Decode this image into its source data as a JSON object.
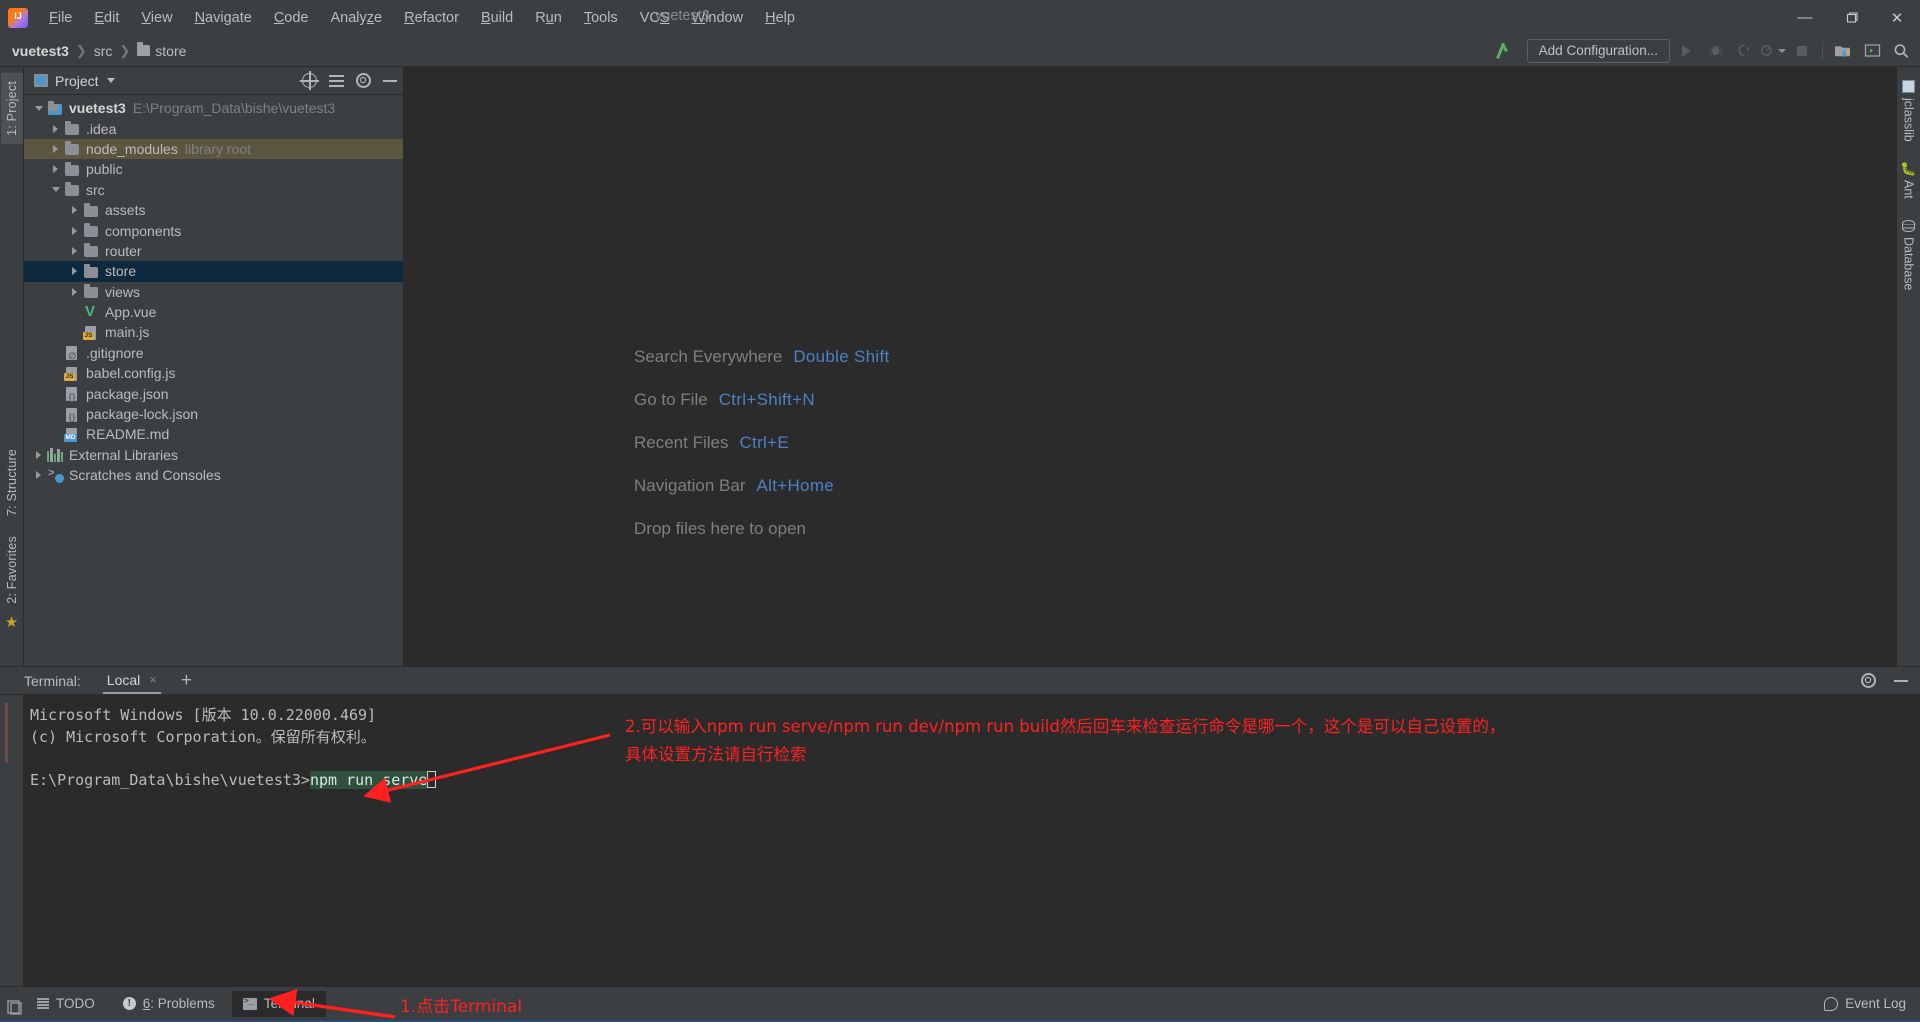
{
  "window": {
    "title": "vuetest3",
    "controls": {
      "minimize": "—",
      "maximize": "❐",
      "close": "✕"
    }
  },
  "menubar": {
    "items": [
      {
        "label": "File",
        "mnemonic": "F"
      },
      {
        "label": "Edit",
        "mnemonic": "E"
      },
      {
        "label": "View",
        "mnemonic": "V"
      },
      {
        "label": "Navigate",
        "mnemonic": "N"
      },
      {
        "label": "Code",
        "mnemonic": "C"
      },
      {
        "label": "Analyze",
        "mnemonic": "z"
      },
      {
        "label": "Refactor",
        "mnemonic": "R"
      },
      {
        "label": "Build",
        "mnemonic": "B"
      },
      {
        "label": "Run",
        "mnemonic": "u"
      },
      {
        "label": "Tools",
        "mnemonic": "T"
      },
      {
        "label": "VCS",
        "mnemonic": "S"
      },
      {
        "label": "Window",
        "mnemonic": "W"
      },
      {
        "label": "Help",
        "mnemonic": "H"
      }
    ]
  },
  "navbar": {
    "breadcrumbs": [
      "vuetest3",
      "src",
      "store"
    ],
    "add_configuration": "Add Configuration..."
  },
  "project_panel": {
    "title": "Project",
    "tree": [
      {
        "label": "vuetest3",
        "sub": "E:\\Program_Data\\bishe\\vuetest3",
        "depth": 0,
        "icon": "folder-module",
        "state": "open",
        "style": "bold"
      },
      {
        "label": ".idea",
        "sub": "",
        "depth": 1,
        "icon": "folder",
        "state": "closed"
      },
      {
        "label": "node_modules",
        "sub": "library root",
        "depth": 1,
        "icon": "folder",
        "state": "closed",
        "highlight": "library"
      },
      {
        "label": "public",
        "sub": "",
        "depth": 1,
        "icon": "folder",
        "state": "closed"
      },
      {
        "label": "src",
        "sub": "",
        "depth": 1,
        "icon": "folder",
        "state": "open"
      },
      {
        "label": "assets",
        "sub": "",
        "depth": 2,
        "icon": "folder",
        "state": "closed"
      },
      {
        "label": "components",
        "sub": "",
        "depth": 2,
        "icon": "folder",
        "state": "closed"
      },
      {
        "label": "router",
        "sub": "",
        "depth": 2,
        "icon": "folder",
        "state": "closed"
      },
      {
        "label": "store",
        "sub": "",
        "depth": 2,
        "icon": "folder",
        "state": "closed",
        "selected": true
      },
      {
        "label": "views",
        "sub": "",
        "depth": 2,
        "icon": "folder",
        "state": "closed"
      },
      {
        "label": "App.vue",
        "sub": "",
        "depth": 2,
        "icon": "vue",
        "state": "leaf"
      },
      {
        "label": "main.js",
        "sub": "",
        "depth": 2,
        "icon": "js",
        "state": "leaf"
      },
      {
        "label": ".gitignore",
        "sub": "",
        "depth": 1,
        "icon": "gitignore",
        "state": "leaf"
      },
      {
        "label": "babel.config.js",
        "sub": "",
        "depth": 1,
        "icon": "js",
        "state": "leaf"
      },
      {
        "label": "package.json",
        "sub": "",
        "depth": 1,
        "icon": "json",
        "state": "leaf"
      },
      {
        "label": "package-lock.json",
        "sub": "",
        "depth": 1,
        "icon": "json",
        "state": "leaf"
      },
      {
        "label": "README.md",
        "sub": "",
        "depth": 1,
        "icon": "md",
        "state": "leaf"
      },
      {
        "label": "External Libraries",
        "sub": "",
        "depth": 0,
        "icon": "libraries",
        "state": "closed"
      },
      {
        "label": "Scratches and Consoles",
        "sub": "",
        "depth": 0,
        "icon": "scratches",
        "state": "closed"
      }
    ]
  },
  "left_strip": {
    "tabs": [
      "1: Project"
    ],
    "bottom_tabs": [
      "7: Structure",
      "2: Favorites"
    ]
  },
  "right_strip": {
    "tabs": [
      "jclasslib",
      "Ant",
      "Database"
    ]
  },
  "editor": {
    "hints": [
      {
        "action": "Search Everywhere",
        "shortcut": "Double Shift"
      },
      {
        "action": "Go to File",
        "shortcut": "Ctrl+Shift+N"
      },
      {
        "action": "Recent Files",
        "shortcut": "Ctrl+E"
      },
      {
        "action": "Navigation Bar",
        "shortcut": "Alt+Home"
      },
      {
        "action": "Drop files here to open",
        "shortcut": ""
      }
    ]
  },
  "terminal": {
    "label": "Terminal:",
    "tab": "Local",
    "close": "×",
    "add": "+",
    "lines": [
      "Microsoft Windows [版本 10.0.22000.469]",
      "(c) Microsoft Corporation。保留所有权利。",
      ""
    ],
    "prompt": "E:\\Program_Data\\bishe\\vuetest3>",
    "command": "npm run serve"
  },
  "annotations": [
    {
      "id": "anno-terminal-click",
      "text": "1.点击Terminal",
      "color": "#ff2020"
    },
    {
      "id": "anno-npm-commands",
      "line1": "2.可以输入npm run serve/npm run dev/npm run build然后回车来检查运行命令是哪一个，这个是可以自己设置的，",
      "line2": "具体设置方法请自行检索",
      "color": "#ff2020"
    }
  ],
  "statusbar": {
    "tabs": [
      {
        "label": "TODO",
        "icon": "todo-icon",
        "active": false
      },
      {
        "label": "6: Problems",
        "icon": "problems-icon",
        "active": false,
        "mnemonic": "6"
      },
      {
        "label": "Terminal",
        "icon": "terminal-icon",
        "active": true
      }
    ],
    "event_log": "Event Log"
  },
  "colors": {
    "accent_blue": "#4d81c4",
    "selection_blue": "#0d293e",
    "library_highlight": "#5c5640",
    "annotation_red": "#ff2020",
    "panel_bg": "#3c3f41",
    "editor_bg": "#2b2b2b",
    "vue_green": "#41b883",
    "terminal_selection": "#2f4f3f"
  }
}
